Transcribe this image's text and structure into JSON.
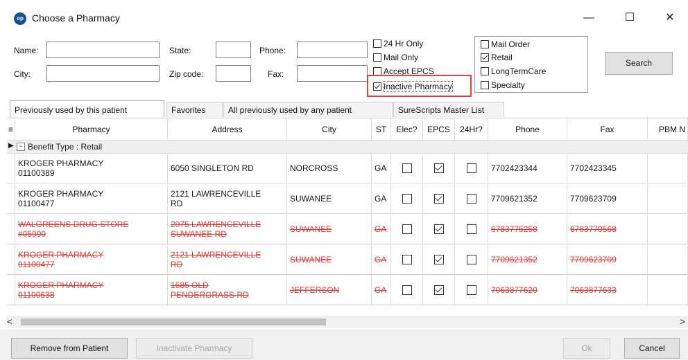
{
  "window": {
    "title": "Choose a Pharmacy",
    "minimize": "—",
    "maximize": "☐",
    "close": "✕"
  },
  "filters": {
    "name_label": "Name:",
    "city_label": "City:",
    "state_label": "State:",
    "zip_label": "Zip code:",
    "phone_label": "Phone:",
    "fax_label": "Fax:",
    "name_value": "",
    "city_value": "",
    "state_value": "",
    "zip_value": "",
    "phone_value": "",
    "fax_value": ""
  },
  "options": [
    {
      "label": "24 Hr Only",
      "checked": false
    },
    {
      "label": "Mail Only",
      "checked": false
    },
    {
      "label": "Accept EPCS",
      "checked": false
    },
    {
      "label": "Inactive Pharmacy",
      "checked": true
    }
  ],
  "types": [
    {
      "label": "Mail Order",
      "checked": false
    },
    {
      "label": "Retail",
      "checked": true
    },
    {
      "label": "LongTermCare",
      "checked": false
    },
    {
      "label": "Specialty",
      "checked": false
    }
  ],
  "search_button": "Search",
  "tabs": [
    {
      "label": "Previously used by this patient",
      "active": true
    },
    {
      "label": "Favorites",
      "active": false
    },
    {
      "label": "All previously used by any patient",
      "active": false
    },
    {
      "label": "SureScripts Master List",
      "active": false
    }
  ],
  "grid": {
    "columns": [
      "Pharmacy",
      "Address",
      "City",
      "ST",
      "Elec?",
      "EPCS",
      "24Hr?",
      "Phone",
      "Fax",
      "PBM N"
    ],
    "group_label": "Benefit Type : Retail",
    "rows": [
      {
        "pharmacy": "KROGER PHARMACY\n01100389",
        "address": "6050 SINGLETON RD",
        "city": "NORCROSS",
        "st": "GA",
        "elec": false,
        "epcs": true,
        "hr24": false,
        "phone": "7702423344",
        "fax": "7702423345",
        "inactive": false
      },
      {
        "pharmacy": "KROGER PHARMACY\n01100477",
        "address": "2121 LAWRENCEVILLE\nRD",
        "city": "SUWANEE",
        "st": "GA",
        "elec": false,
        "epcs": true,
        "hr24": false,
        "phone": "7709621352",
        "fax": "7709623709",
        "inactive": false
      },
      {
        "pharmacy": "WALGREENS DRUG STORE\n#05990",
        "address": "2075 LAWRENCEVILLE\nSUWANEE RD",
        "city": "SUWANEE",
        "st": "GA",
        "elec": false,
        "epcs": true,
        "hr24": false,
        "phone": "6783775258",
        "fax": "6783770568",
        "inactive": true
      },
      {
        "pharmacy": "KROGER PHARMACY\n01100477",
        "address": "2121 LAWRENCEVILLE\nRD",
        "city": "SUWANEE",
        "st": "GA",
        "elec": false,
        "epcs": true,
        "hr24": false,
        "phone": "7709621352",
        "fax": "7709623709",
        "inactive": true
      },
      {
        "pharmacy": "KROGER PHARMACY\n01100638",
        "address": "1685 OLD\nPENDERGRASS RD",
        "city": "JEFFERSON",
        "st": "GA",
        "elec": false,
        "epcs": true,
        "hr24": false,
        "phone": "7063877620",
        "fax": "7063877633",
        "inactive": true
      }
    ]
  },
  "scroll": {
    "left": "<",
    "right": ">"
  },
  "buttons": {
    "remove": "Remove from Patient",
    "inactivate": "Inactivate Pharmacy",
    "ok": "Ok",
    "cancel": "Cancel"
  },
  "colors": {
    "inactive_text": "#e53935",
    "highlight_box": "#e0423a",
    "app_icon": "#16528f"
  }
}
